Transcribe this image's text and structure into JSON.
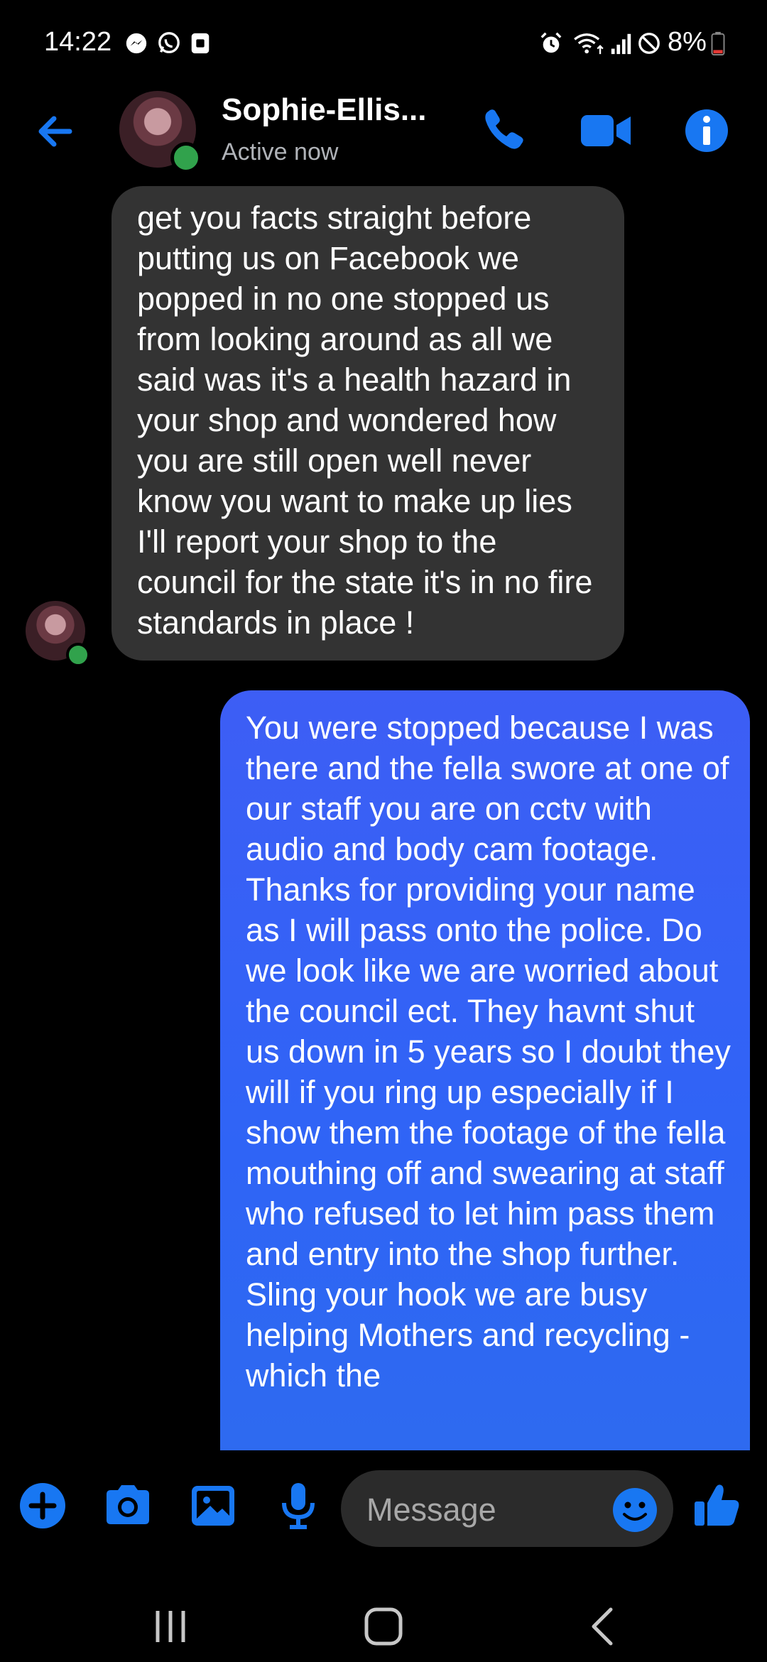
{
  "status_bar": {
    "time": "14:22",
    "battery": "8%",
    "notification_icons": [
      "messenger-icon",
      "whatsapp-icon",
      "notification-icon"
    ],
    "system_icons": [
      "alarm-icon",
      "wifi-icon",
      "signal-icon",
      "do-not-disturb-icon",
      "battery-icon"
    ]
  },
  "header": {
    "contact_name": "Sophie-Ellis...",
    "status": "Active now"
  },
  "messages": [
    {
      "direction": "incoming",
      "text": "get you facts straight before putting us on Facebook we popped in no one stopped us from looking around as all we said was it's a health hazard in your shop and wondered how you are still open well never know you want to make up lies I'll report your shop to the council for the state it's in no fire standards in place !"
    },
    {
      "direction": "outgoing",
      "text": "You were stopped because I was there and the fella swore at one of our staff you are on cctv with audio and body cam footage. Thanks for providing your name as I will pass onto the police. Do we look like we are worried about the council ect. They havnt shut us down in 5 years so I doubt they will if you ring up especially if I show them the footage of the fella mouthing off and swearing at staff  who refused to let him pass them and entry into the shop further. Sling your hook we are busy helping Mothers and recycling - which the"
    }
  ],
  "composer": {
    "placeholder": "Message"
  },
  "colors": {
    "accent": "#1877f2",
    "outgoing_bubble": "#2f64f6",
    "incoming_bubble": "#333333",
    "online": "#31a24c",
    "battery_low": "#e53935"
  }
}
